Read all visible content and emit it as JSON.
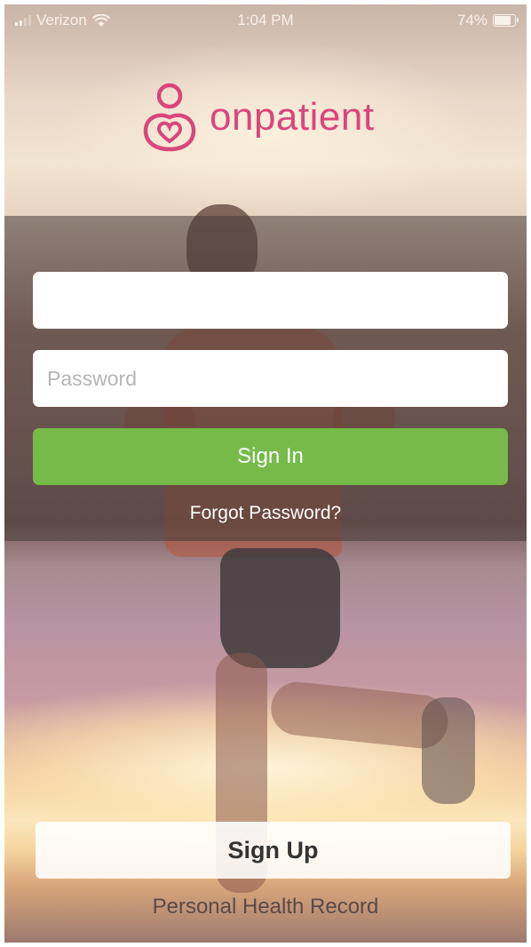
{
  "status_bar": {
    "carrier": "Verizon",
    "time": "1:04 PM",
    "battery_percent": "74%",
    "battery_level": 0.74,
    "icons": [
      "signal-icon",
      "wifi-icon",
      "battery-icon"
    ]
  },
  "brand": {
    "name": "onpatient",
    "logo_icon": "heart-person-icon",
    "color": "#d9467a"
  },
  "login": {
    "username_value": "",
    "username_placeholder": "",
    "password_placeholder": "Password",
    "signin_label": "Sign In",
    "signin_color": "#76bb49",
    "forgot_label": "Forgot Password?"
  },
  "footer": {
    "signup_label": "Sign Up",
    "tagline": "Personal Health Record"
  }
}
